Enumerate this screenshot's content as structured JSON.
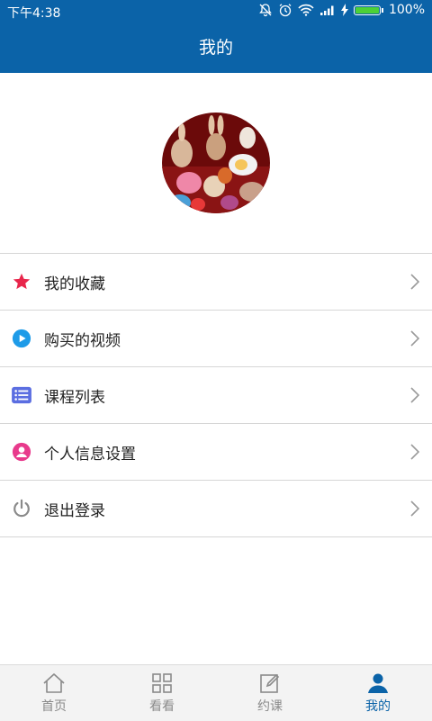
{
  "status": {
    "time": "下午4:38",
    "battery": "100%"
  },
  "header": {
    "title": "我的"
  },
  "menu": [
    {
      "label": "我的收藏",
      "icon": "star-icon"
    },
    {
      "label": "购买的视频",
      "icon": "play-circle-icon"
    },
    {
      "label": "课程列表",
      "icon": "list-icon"
    },
    {
      "label": "个人信息设置",
      "icon": "user-circle-icon"
    },
    {
      "label": "退出登录",
      "icon": "power-icon"
    }
  ],
  "tabs": [
    {
      "label": "首页",
      "icon": "home-icon"
    },
    {
      "label": "看看",
      "icon": "grid-icon"
    },
    {
      "label": "约课",
      "icon": "edit-icon"
    },
    {
      "label": "我的",
      "icon": "user-icon",
      "active": true
    }
  ],
  "colors": {
    "primary": "#0b63a8",
    "star": "#e8264b",
    "play": "#1e9be8",
    "list": "#5b6ee1",
    "user": "#e83a8c",
    "power": "#8a8a8a"
  }
}
